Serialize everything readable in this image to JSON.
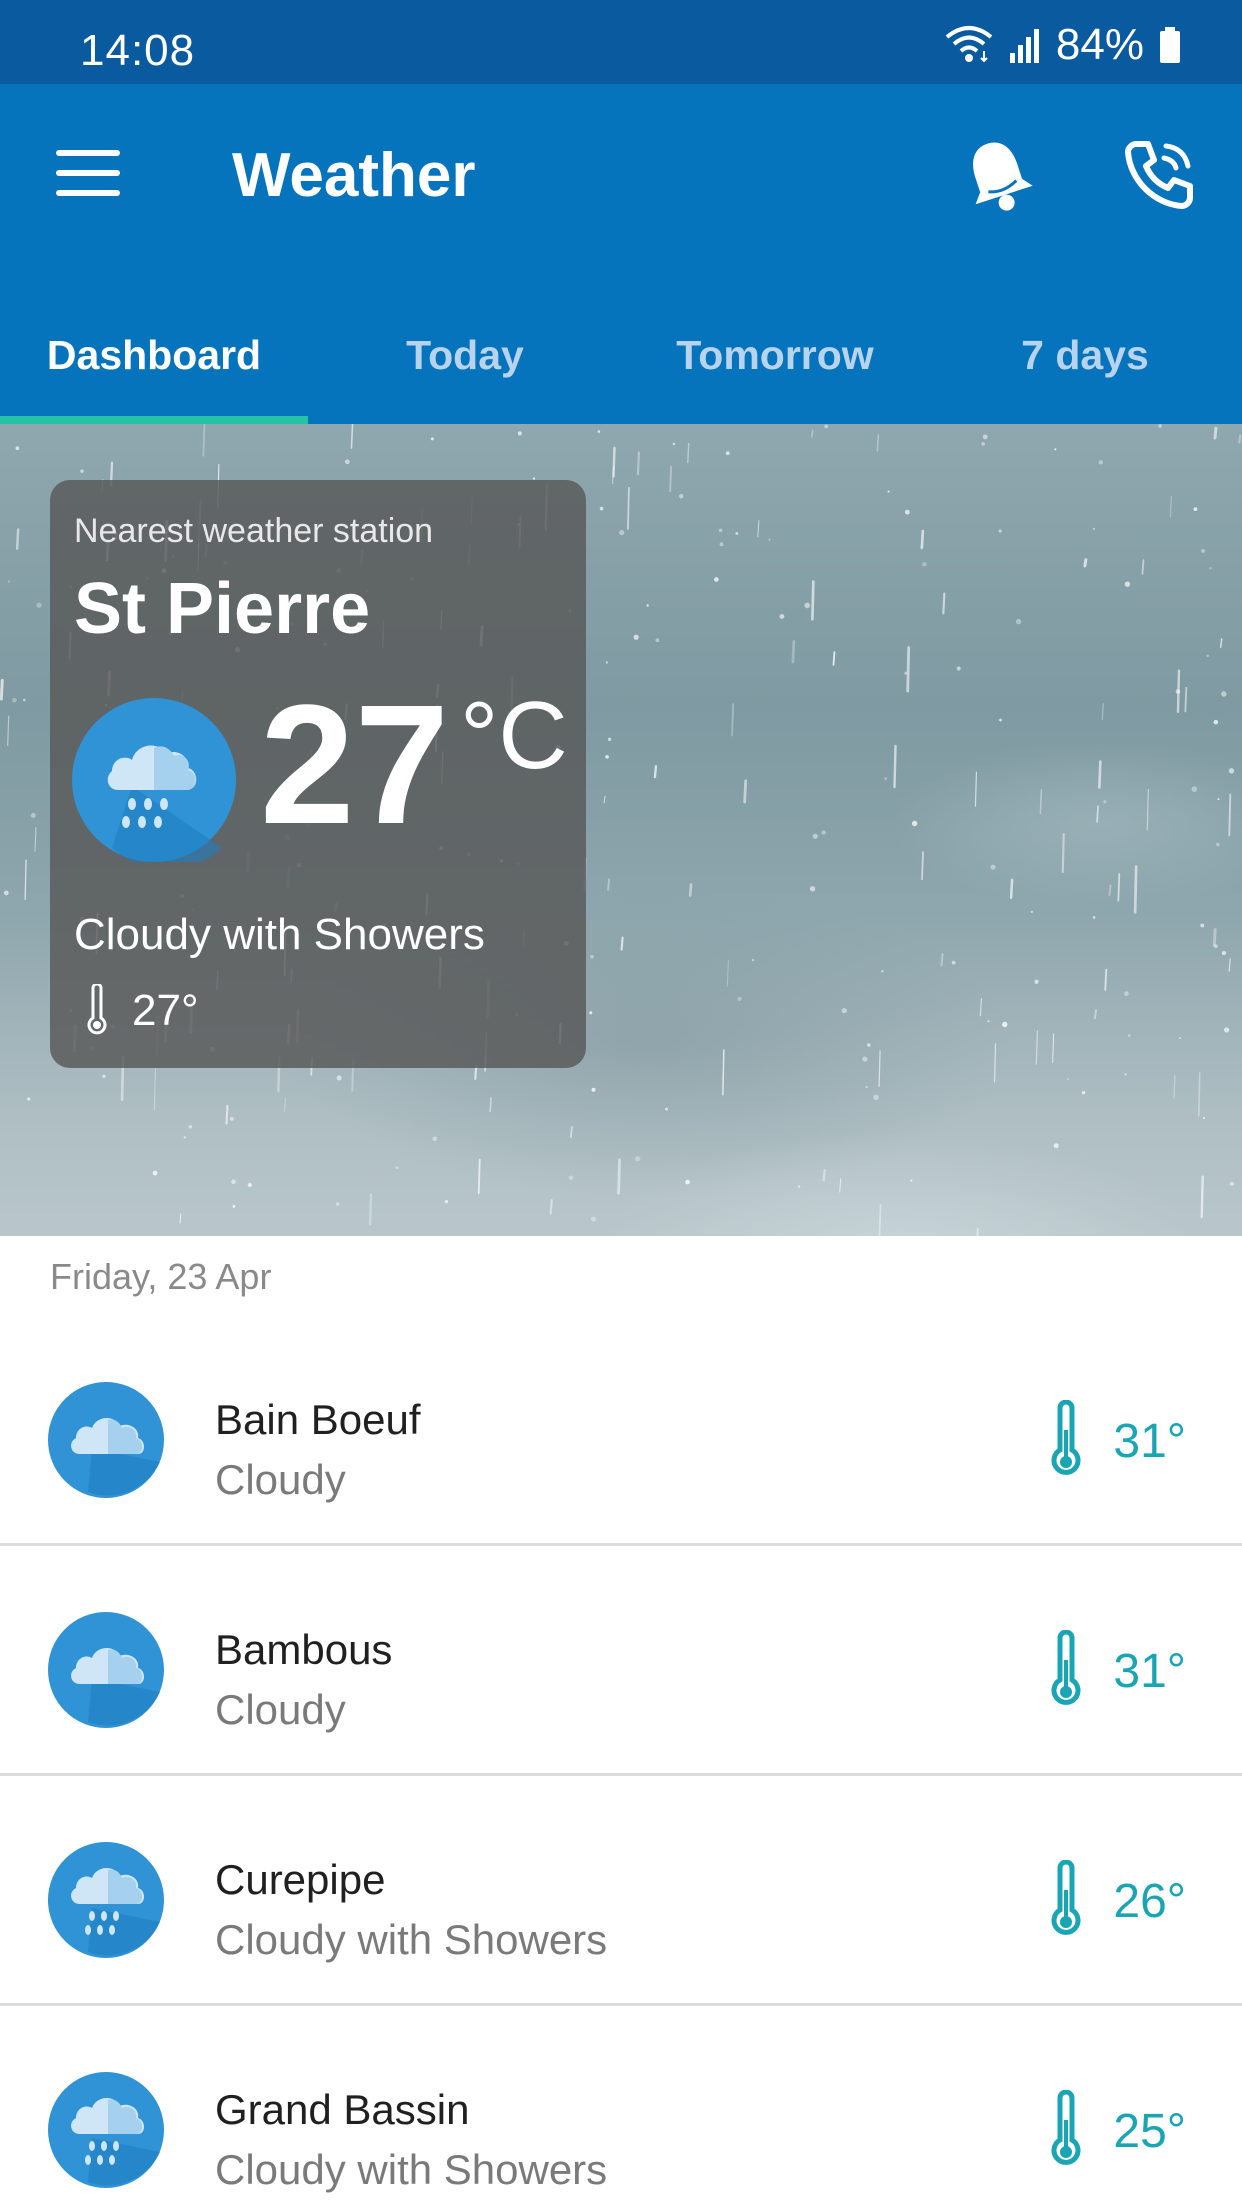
{
  "status_bar": {
    "time": "14:08",
    "battery": "84%",
    "icons": [
      "wifi-icon",
      "signal-icon",
      "battery-icon"
    ]
  },
  "app_bar": {
    "title": "Weather",
    "menu_icon": "menu-icon",
    "alerts_icon": "bell-icon",
    "contact_icon": "phone-icon",
    "color": "#0673bd"
  },
  "tabs": [
    {
      "label": "Dashboard",
      "active": true
    },
    {
      "label": "Today",
      "active": false
    },
    {
      "label": "Tomorrow",
      "active": false
    },
    {
      "label": "7 days",
      "active": false
    }
  ],
  "tab_indicator_color": "#24c3a6",
  "nearest_station": {
    "caption": "Nearest weather station",
    "name": "St Pierre",
    "temperature": "27",
    "unit": "°C",
    "condition": "Cloudy with Showers",
    "feels_like": "27°",
    "icon": "cloud-rain-icon"
  },
  "forecast": {
    "date": "Friday, 23 Apr",
    "accent_color": "#1aa5b5",
    "items": [
      {
        "name": "Bain Boeuf",
        "condition": "Cloudy",
        "temperature": "31°",
        "icon": "cloud-icon"
      },
      {
        "name": "Bambous",
        "condition": "Cloudy",
        "temperature": "31°",
        "icon": "cloud-icon"
      },
      {
        "name": "Curepipe",
        "condition": "Cloudy with Showers",
        "temperature": "26°",
        "icon": "cloud-rain-icon"
      },
      {
        "name": "Grand Bassin",
        "condition": "Cloudy with Showers",
        "temperature": "25°",
        "icon": "cloud-rain-icon"
      }
    ]
  }
}
